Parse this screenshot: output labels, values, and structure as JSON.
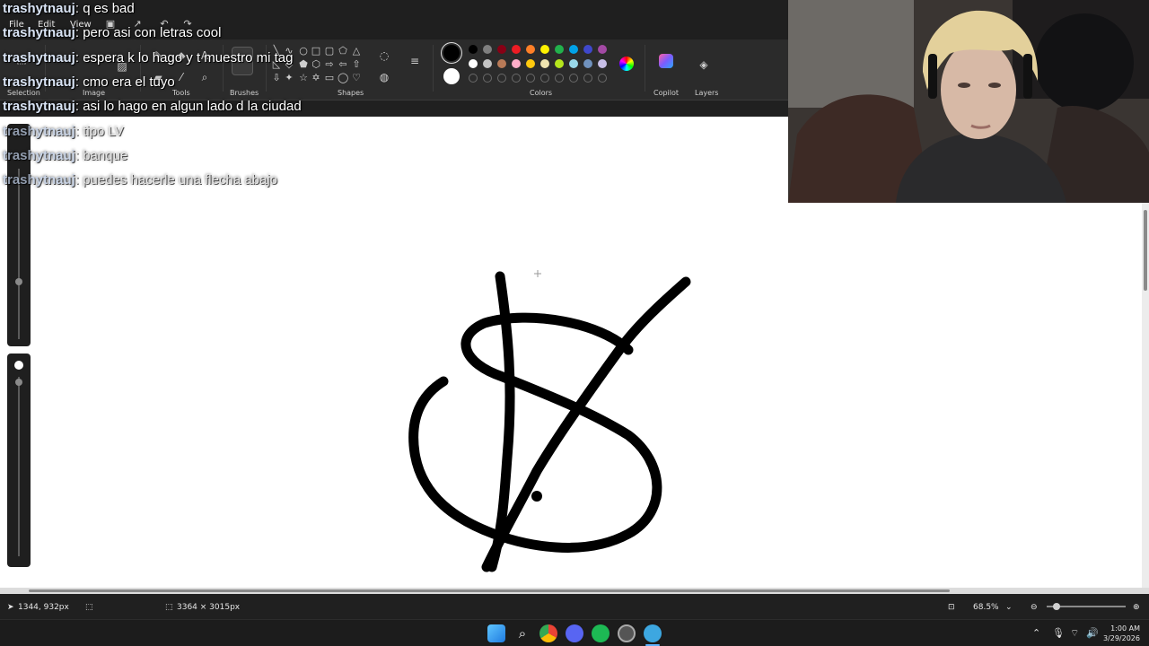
{
  "menu": {
    "items": [
      "File",
      "Edit",
      "View"
    ]
  },
  "ribbon": {
    "groups": {
      "selection": "Selection",
      "image": "Image",
      "tools": "Tools",
      "brushes": "Brushes",
      "shapes": "Shapes",
      "colors": "Colors",
      "copilot": "Copilot",
      "layers": "Layers"
    },
    "palette_row1": [
      "#000000",
      "#7f7f7f",
      "#880015",
      "#ed1c24",
      "#ff7f27",
      "#fff200",
      "#22b14c",
      "#00a2e8",
      "#3f48cc",
      "#a349a4"
    ],
    "palette_row2": [
      "#ffffff",
      "#c3c3c3",
      "#b97a57",
      "#ffaec9",
      "#ffc90e",
      "#efe4b0",
      "#b5e61d",
      "#99d9ea",
      "#7092be",
      "#c8bfe7"
    ],
    "primary_color": "#000000",
    "secondary_color": "#ffffff"
  },
  "chat": [
    {
      "user": "trashytnauj",
      "msg": "q es bad",
      "faded": false
    },
    {
      "user": "trashytnauj",
      "msg": "pero asi con letras cool",
      "faded": false
    },
    {
      "user": "trashytnauj",
      "msg": "espera k lo hago y t muestro mi tag",
      "faded": false
    },
    {
      "user": "trashytnauj",
      "msg": "cmo era el tuyo",
      "faded": false
    },
    {
      "user": "trashytnauj",
      "msg": "asi lo hago en algun lado d la ciudad",
      "faded": false
    },
    {
      "user": "trashytnauj",
      "msg": "tipo LV",
      "faded": true
    },
    {
      "user": "trashytnauj",
      "msg": "banque",
      "faded": true
    },
    {
      "user": "trashytnauj",
      "msg": "puedes hacerle una flecha abajo",
      "faded": true
    }
  ],
  "status": {
    "cursor_pos": "1344, 932px",
    "canvas_size": "3364 × 3015px",
    "zoom": "68.5%"
  },
  "taskbar": {
    "time": "1:00 AM",
    "date": "3/29/2026"
  }
}
